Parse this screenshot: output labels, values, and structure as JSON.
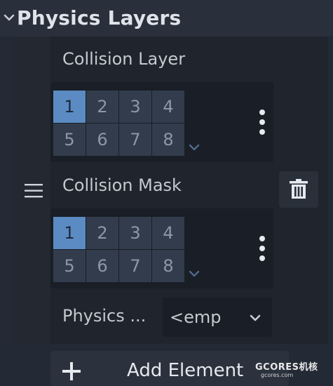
{
  "section": {
    "title": "Physics Layers"
  },
  "collision_layer": {
    "label": "Collision Layer",
    "cells": [
      "1",
      "2",
      "3",
      "4",
      "5",
      "6",
      "7",
      "8"
    ],
    "active": [
      0
    ]
  },
  "collision_mask": {
    "label": "Collision Mask",
    "cells": [
      "1",
      "2",
      "3",
      "4",
      "5",
      "6",
      "7",
      "8"
    ],
    "active": [
      0
    ]
  },
  "physics_material": {
    "label": "Physics ...",
    "value": "<emp"
  },
  "add_element": {
    "label": "Add Element"
  },
  "watermark": {
    "text": "GCORES机核",
    "url_text": "gcores.com"
  },
  "icons": {
    "header_chevron": "chevron-down-icon",
    "drag_handle": "hamburger-icon",
    "delete": "trash-icon",
    "menu": "kebab-menu-icon",
    "expand": "chevron-down-icon",
    "add": "plus-icon"
  },
  "colors": {
    "background": "#242a35",
    "panel": "#1f242d",
    "cell_active": "#5b8bc2",
    "cell_inactive": "#323c4c"
  }
}
